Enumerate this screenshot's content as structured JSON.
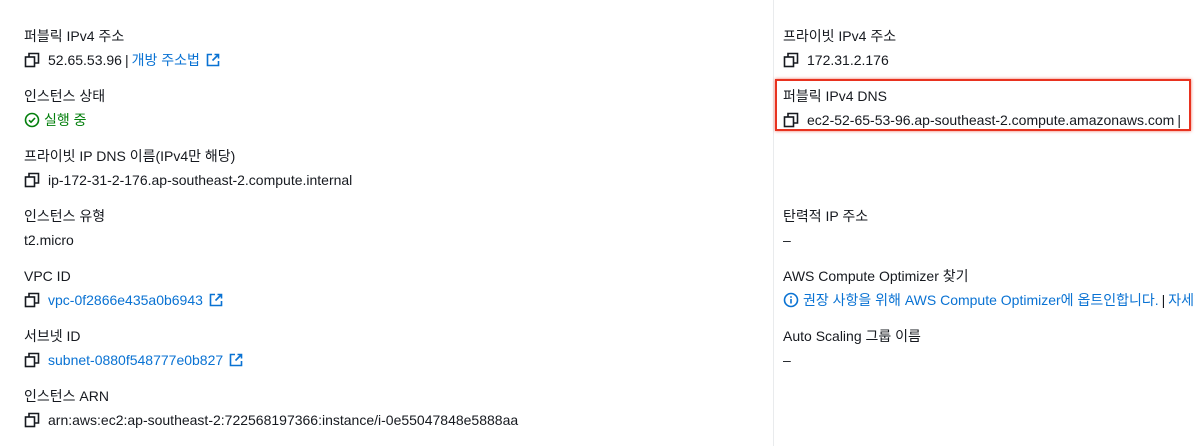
{
  "left": {
    "public_ipv4": {
      "label": "퍼블릭 IPv4 주소",
      "value": "52.65.53.96",
      "separator": "|",
      "link": "개방 주소법"
    },
    "instance_state": {
      "label": "인스턴스 상태",
      "value": "실행 중"
    },
    "private_ip_dns": {
      "label": "프라이빗 IP DNS 이름(IPv4만 해당)",
      "value": "ip-172-31-2-176.ap-southeast-2.compute.internal"
    },
    "instance_type": {
      "label": "인스턴스 유형",
      "value": "t2.micro"
    },
    "vpc_id": {
      "label": "VPC ID",
      "value": "vpc-0f2866e435a0b6943"
    },
    "subnet_id": {
      "label": "서브넷 ID",
      "value": "subnet-0880f548777e0b827"
    },
    "instance_arn": {
      "label": "인스턴스 ARN",
      "value": "arn:aws:ec2:ap-southeast-2:722568197366:instance/i-0e55047848e5888aa"
    }
  },
  "right": {
    "private_ipv4": {
      "label": "프라이빗 IPv4 주소",
      "value": "172.31.2.176"
    },
    "public_ipv4_dns": {
      "label": "퍼블릭 IPv4 DNS",
      "value": "ec2-52-65-53-96.ap-southeast-2.compute.amazonaws.com",
      "separator": "|"
    },
    "elastic_ip": {
      "label": "탄력적 IP 주소",
      "value": "–"
    },
    "compute_optimizer": {
      "label": "AWS Compute Optimizer 찾기",
      "link": "권장 사항을 위해 AWS Compute Optimizer에 옵트인합니다.",
      "separator": "|",
      "more_link": "자세히"
    },
    "auto_scaling": {
      "label": "Auto Scaling 그룹 이름",
      "value": "–"
    }
  },
  "colors": {
    "link": "#0972d3",
    "success": "#037f0c",
    "highlight_border": "#e8321f",
    "text": "#16191f"
  },
  "icons": [
    "copy-icon",
    "external-link-icon",
    "status-check-icon",
    "info-icon"
  ]
}
